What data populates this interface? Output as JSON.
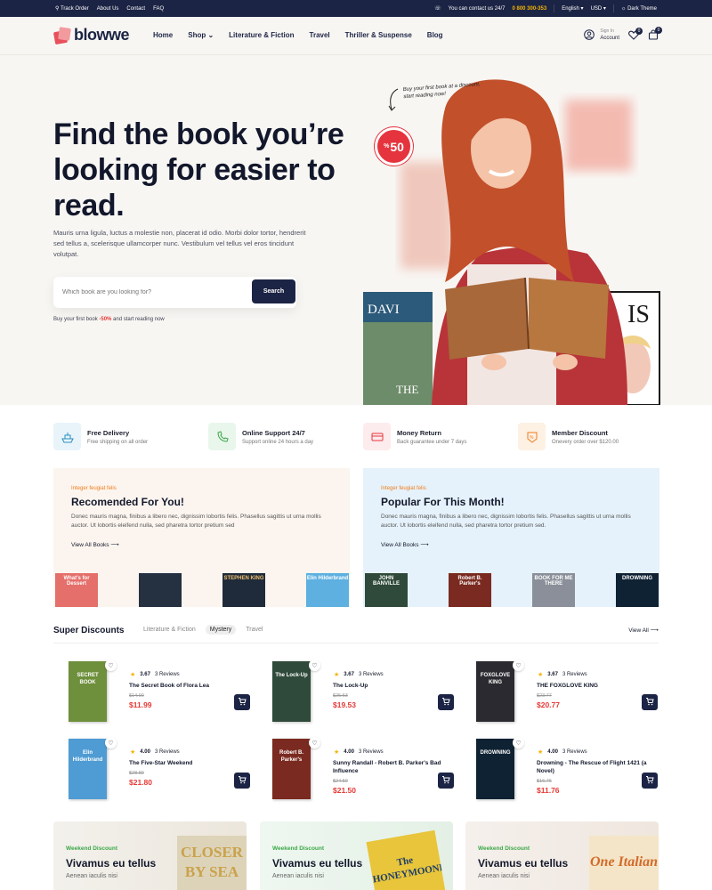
{
  "topbar": {
    "links": [
      "Track Order",
      "About Us",
      "Contact",
      "FAQ"
    ],
    "contact_text": "You can contact us 24/7",
    "phone": "0 800 300-353",
    "language": "English",
    "currency": "USD",
    "theme_label": "Dark Theme"
  },
  "header": {
    "logo": "blowwe",
    "nav": [
      "Home",
      "Shop",
      "Literature & Fiction",
      "Travel",
      "Thriller & Suspense",
      "Blog"
    ],
    "account_small": "Sign In",
    "account_label": "Account",
    "wishlist_count": "0",
    "cart_count": "0"
  },
  "hero": {
    "title": "Find the book you’re looking for easier to read.",
    "description": "Mauris urna ligula, luctus a molestie non, placerat id odio. Morbi dolor tortor, hendrerit sed tellus a, scelerisque ullamcorper nunc. Vestibulum vel tellus vel eros tincidunt volutpat.",
    "search_placeholder": "Which book are you looking for?",
    "search_button": "Search",
    "promo_prefix": "Buy your first book",
    "promo_value": "-50%",
    "promo_suffix": "and start reading now",
    "annotation": "Buy your first book at a discount, start reading now!",
    "discount": "50",
    "discount_symbol": "%"
  },
  "features": [
    {
      "title": "Free Delivery",
      "subtitle": "Free shipping on all order",
      "icon": "ship-icon"
    },
    {
      "title": "Online Support 24/7",
      "subtitle": "Support online 24 hours a day",
      "icon": "support-phone-icon"
    },
    {
      "title": "Money Return",
      "subtitle": "Back guarantee under 7 days",
      "icon": "money-card-icon"
    },
    {
      "title": "Member Discount",
      "subtitle": "Onevery order over $120.00",
      "icon": "discount-tag-icon"
    }
  ],
  "panels": [
    {
      "tag": "Integer feugiat felis",
      "title": "Recomended For You!",
      "text": "Donec mauris magna, finibus a libero nec, dignissim lobortis felis. Phasellus sagittis ut urna mollis auctor. Ut lobortis eleifend nulla, sed pharetra tortor pretium sed",
      "link": "View All Books",
      "books": [
        "What's for Dessert",
        "",
        "STEPHEN KING",
        "Elin Hilderbrand"
      ]
    },
    {
      "tag": "Integer feugiat felis",
      "title": "Popular For This Month!",
      "text": "Donec mauris magna, finibus a libero nec, dignissim lobortis felis. Phasellus sagittis ut urna mollis auctor. Ut lobortis eleifend nulla, sed pharetra tortor pretium sed.",
      "link": "View All Books",
      "books": [
        "JOHN BANVILLE",
        "Robert B. Parker's",
        "BOOK FOR ME THERE",
        "DROWNING"
      ]
    }
  ],
  "super_discounts": {
    "title": "Super Discounts",
    "tabs": [
      "Literature & Fiction",
      "Mystery",
      "Travel"
    ],
    "active_tab": "Mystery",
    "view_all": "View All",
    "products": [
      {
        "name": "The Secret Book of Flora Lea",
        "rating": "3.67",
        "reviews": "3 Reviews",
        "old_price": "$14.90",
        "price": "$11.99",
        "cover_text": "SECRET BOOK",
        "cover_color": "#6e8f3b"
      },
      {
        "name": "The Lock-Up",
        "rating": "3.67",
        "reviews": "3 Reviews",
        "old_price": "$25.53",
        "price": "$19.53",
        "cover_text": "The Lock-Up",
        "cover_color": "#2f4a3a"
      },
      {
        "name": "THE FOXGLOVE KING",
        "rating": "3.67",
        "reviews": "3 Reviews",
        "old_price": "$23.77",
        "price": "$20.77",
        "cover_text": "FOXGLOVE KING",
        "cover_color": "#2b2a30"
      },
      {
        "name": "The Five-Star Weekend",
        "rating": "4.00",
        "reviews": "3 Reviews",
        "old_price": "$28.80",
        "price": "$21.80",
        "cover_text": "Elin Hilderbrand",
        "cover_color": "#4f9bd3"
      },
      {
        "name": "Sunny Randall - Robert B. Parker's Bad Influence",
        "rating": "4.00",
        "reviews": "3 Reviews",
        "old_price": "$24.50",
        "price": "$21.50",
        "cover_text": "Robert B. Parker's",
        "cover_color": "#7a2a20"
      },
      {
        "name": "Drowning - The Rescue of Flight 1421 (a Novel)",
        "rating": "4.00",
        "reviews": "3 Reviews",
        "old_price": "$16.76",
        "price": "$11.76",
        "cover_text": "DROWNING",
        "cover_color": "#0f2233"
      }
    ]
  },
  "weekend": [
    {
      "tag": "Weekend Discount",
      "title": "Vivamus eu tellus",
      "subtitle": "Aenean iaculis nisi",
      "cover": "CLOSER BY SEA"
    },
    {
      "tag": "Weekend Discount",
      "title": "Vivamus eu tellus",
      "subtitle": "Aenean iaculis nisi",
      "cover": "The HONEYMOONERS"
    },
    {
      "tag": "Weekend Discount",
      "title": "Vivamus eu tellus",
      "subtitle": "Aenean iaculis nisi",
      "cover": "One Italian"
    }
  ],
  "colors": {
    "navy": "#1c2445",
    "accent_red": "#e53935",
    "orange": "#f07c1a",
    "green": "#3ca848"
  }
}
